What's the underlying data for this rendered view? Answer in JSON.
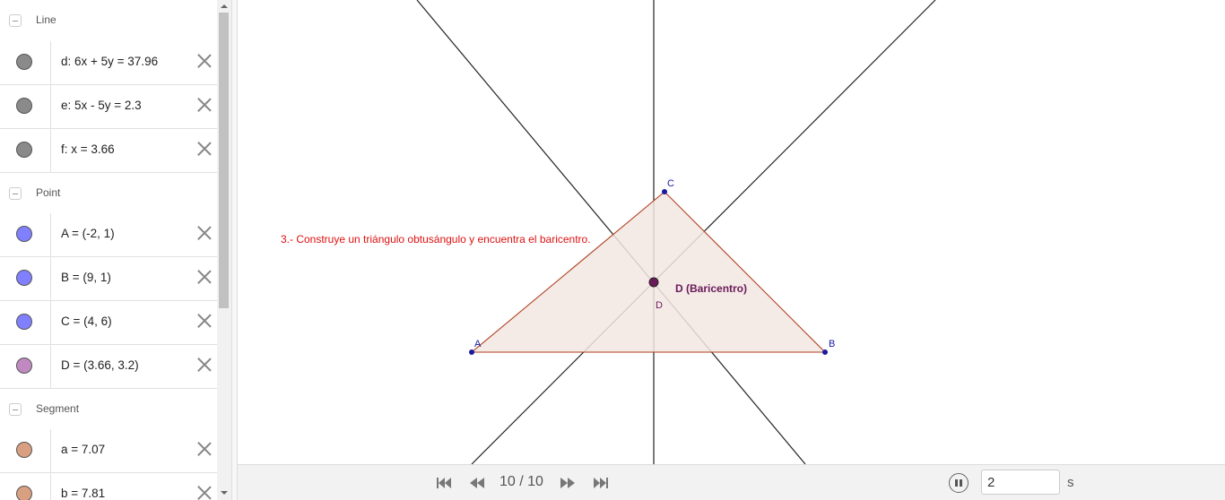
{
  "algebra": {
    "groups": [
      {
        "title": "Line",
        "items": [
          {
            "expr": "d: 6x + 5y = 37.96",
            "color": "#8a8a8a"
          },
          {
            "expr": "e: 5x - 5y = 2.3",
            "color": "#8a8a8a"
          },
          {
            "expr": "f: x = 3.66",
            "color": "#8a8a8a"
          }
        ]
      },
      {
        "title": "Point",
        "items": [
          {
            "expr": "A = (-2, 1)",
            "color": "#8080ff"
          },
          {
            "expr": "B = (9, 1)",
            "color": "#8080ff"
          },
          {
            "expr": "C = (4, 6)",
            "color": "#8080ff"
          },
          {
            "expr": "D = (3.66, 3.2)",
            "color": "#c08ac0"
          }
        ]
      },
      {
        "title": "Segment",
        "items": [
          {
            "expr": "a = 7.07",
            "color": "#d8a080"
          },
          {
            "expr": "b = 7.81",
            "color": "#d8a080"
          }
        ]
      }
    ]
  },
  "graphics": {
    "instruction": "3.- Construye un triángulo obtusángulo y encuentra el baricentro.",
    "labels": {
      "A": "A",
      "B": "B",
      "C": "C",
      "D": "D",
      "D_caption": "D (Baricentro)"
    },
    "colors": {
      "triangle_fill": "#f2e6e2",
      "triangle_edge": "#b04020",
      "point": "#1a1aa0",
      "centroid": "#6a1a5a",
      "lines": "#222222",
      "instruction": "#dd1111"
    }
  },
  "toolbar": {
    "slide_indicator": "10 / 10",
    "speed_value": "2",
    "speed_unit": "s",
    "buttons": [
      "first-slide-icon",
      "previous-slide-icon",
      "next-slide-icon",
      "last-slide-icon",
      "pause-icon"
    ]
  }
}
